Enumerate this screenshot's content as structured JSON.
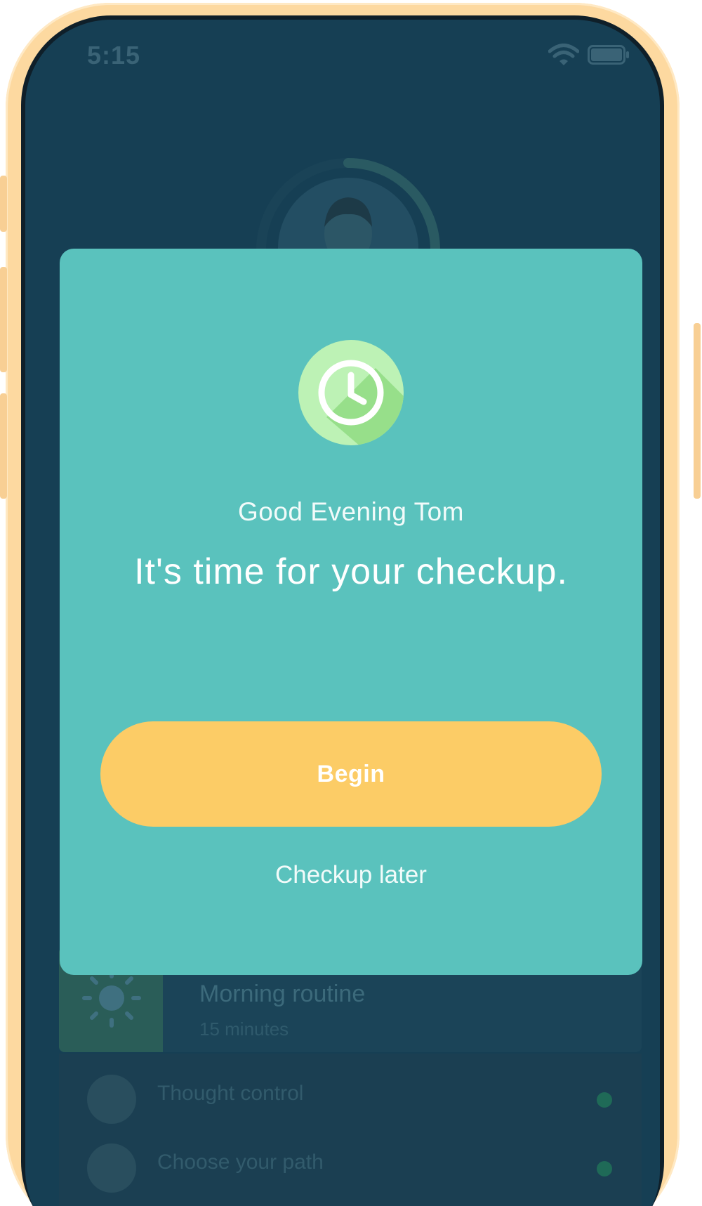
{
  "status_bar": {
    "time": "5:15",
    "wifi_icon": "wifi-icon",
    "battery_icon": "battery-icon"
  },
  "background": {
    "featured_card": {
      "title": "Morning routine",
      "subtitle": "15 minutes",
      "icon": "sun-icon"
    },
    "list_items": [
      {
        "label": "Thought control",
        "icon": "lightbulb-icon"
      },
      {
        "label": "Choose your path",
        "icon": "signpost-icon"
      }
    ]
  },
  "modal": {
    "icon": "clock-icon",
    "greeting": "Good Evening Tom",
    "headline": "It's time for your checkup.",
    "primary_button": "Begin",
    "secondary_link": "Checkup later"
  },
  "colors": {
    "screen_background": "#163f54",
    "modal_background": "#5ac2bd",
    "primary_button": "#fccc66",
    "clock_badge": "#bdf2b5",
    "phone_frame": "#fdd9a0"
  }
}
